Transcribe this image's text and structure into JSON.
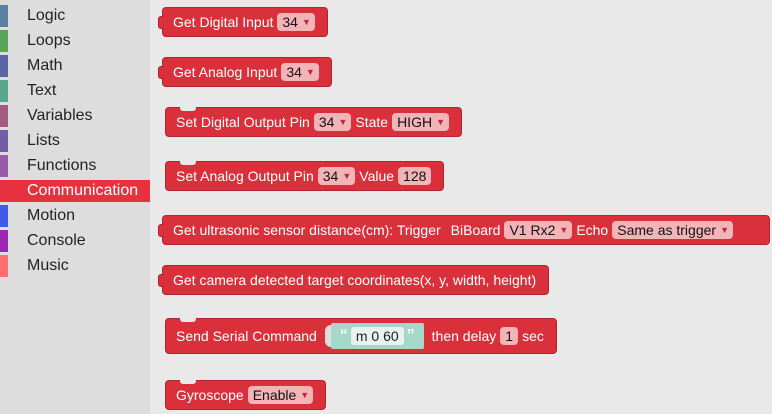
{
  "toolbox": {
    "categories": [
      {
        "label": "Logic",
        "color": "#5b80a5"
      },
      {
        "label": "Loops",
        "color": "#5ba55b"
      },
      {
        "label": "Math",
        "color": "#5b67a5"
      },
      {
        "label": "Text",
        "color": "#5ba58c"
      },
      {
        "label": "Variables",
        "color": "#a55b80"
      },
      {
        "label": "Lists",
        "color": "#745ba5"
      },
      {
        "label": "Functions",
        "color": "#995ba5"
      },
      {
        "label": "Communication",
        "color": "#e8313f"
      },
      {
        "label": "Motion",
        "color": "#3f5be8"
      },
      {
        "label": "Console",
        "color": "#9c27b0"
      },
      {
        "label": "Music",
        "color": "#ff6f6f"
      }
    ],
    "selected": "Communication"
  },
  "blocks": {
    "digital_input": {
      "label": "Get Digital Input",
      "pin": "34"
    },
    "analog_input": {
      "label": "Get Analog Input",
      "pin": "34"
    },
    "digital_output": {
      "label": "Set Digital Output Pin",
      "pin": "34",
      "state_label": "State",
      "state": "HIGH"
    },
    "analog_output": {
      "label": "Set Analog Output Pin",
      "pin": "34",
      "value_label": "Value",
      "value": "128"
    },
    "ultrasonic": {
      "label": "Get ultrasonic sensor distance(cm): Trigger",
      "board": "BiBoard",
      "trigger": "V1 Rx2",
      "echo_label": "Echo",
      "echo": "Same as trigger"
    },
    "camera": {
      "label": "Get camera detected target coordinates(x, y, width, height)"
    },
    "serial": {
      "label": "Send Serial Command",
      "quote_open": "“",
      "command": "m 0 60",
      "quote_close": "”",
      "delay_label": "then delay",
      "delay": "1",
      "unit": "sec"
    },
    "gyroscope": {
      "label": "Gyroscope",
      "mode": "Enable"
    }
  },
  "colors": {
    "block": "#d9303c",
    "field": "#f3b4b8",
    "string": "#a5d8c8"
  }
}
